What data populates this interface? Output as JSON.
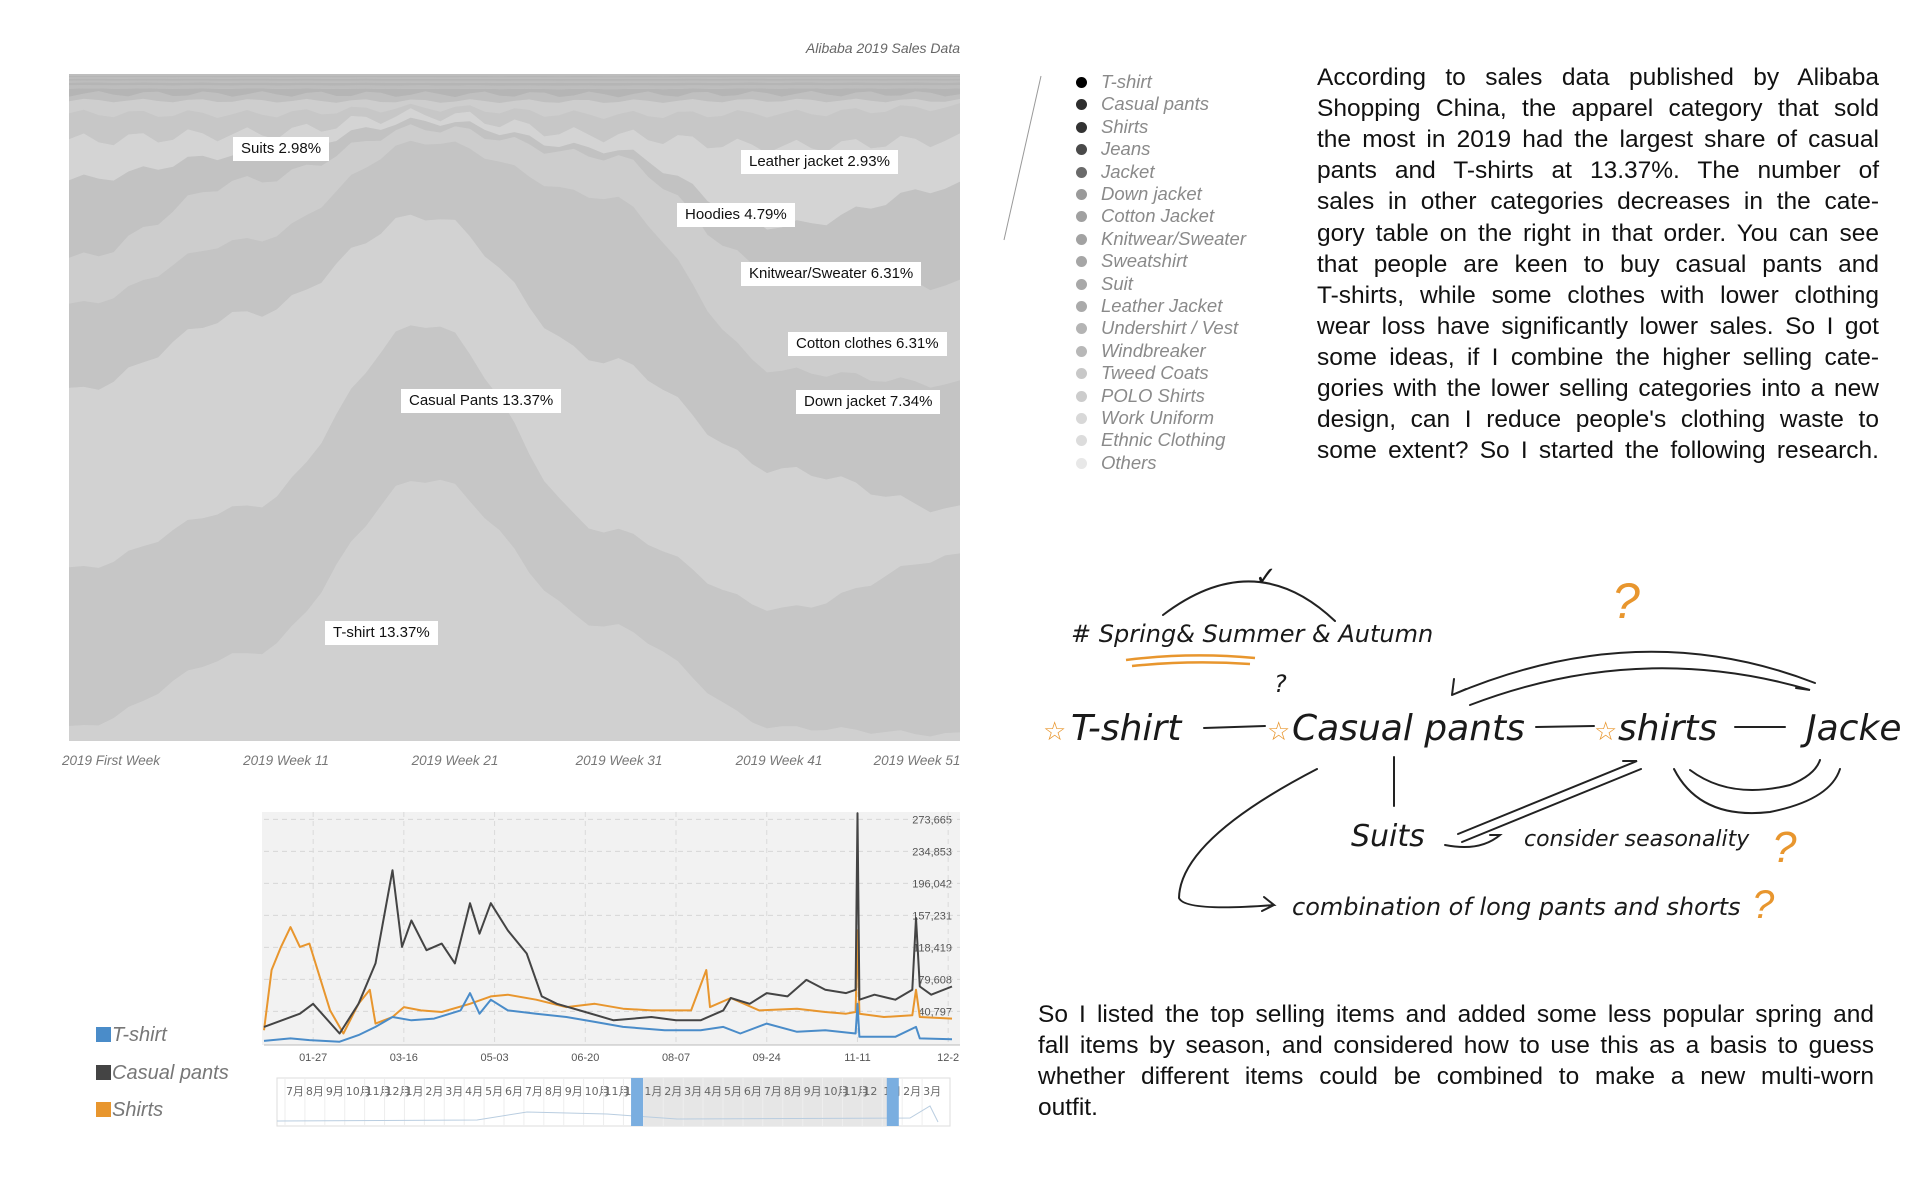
{
  "stream_chart": {
    "title": "Alibaba 2019 Sales Data",
    "week_labels": [
      "2019 First Week",
      "2019 Week 11",
      "2019 Week 21",
      "2019 Week 31",
      "2019 Week 41",
      "2019 Week 51"
    ],
    "labels": [
      {
        "text": "Suits  2.98%"
      },
      {
        "text": "Leather jacket  2.93%"
      },
      {
        "text": "Hoodies  4.79%"
      },
      {
        "text": "Knitwear/Sweater  6.31%"
      },
      {
        "text": "Cotton clothes  6.31%"
      },
      {
        "text": "Down jacket  7.34%"
      },
      {
        "text": "Casual Pants  13.37%"
      },
      {
        "text": "T-shirt  13.37%"
      }
    ]
  },
  "legend": {
    "items": [
      {
        "label": "T-shirt",
        "color": "#000000"
      },
      {
        "label": "Casual pants",
        "color": "#2e2e2e"
      },
      {
        "label": "Shirts",
        "color": "#333333"
      },
      {
        "label": "Jeans",
        "color": "#4a4a4a"
      },
      {
        "label": "Jacket",
        "color": "#6a6a6a"
      },
      {
        "label": "Down jacket",
        "color": "#9a9a9a"
      },
      {
        "label": "Cotton Jacket",
        "color": "#a0a0a0"
      },
      {
        "label": "Knitwear/Sweater",
        "color": "#a2a2a2"
      },
      {
        "label": "Sweatshirt",
        "color": "#a6a6a6"
      },
      {
        "label": "Suit",
        "color": "#a8a8a8"
      },
      {
        "label": "Leather Jacket",
        "color": "#aaaaaa"
      },
      {
        "label": "Undershirt / Vest",
        "color": "#b4b4b4"
      },
      {
        "label": "Windbreaker",
        "color": "#b8b8b8"
      },
      {
        "label": "Tweed Coats",
        "color": "#c8c8c8"
      },
      {
        "label": "POLO Shirts",
        "color": "#cccccc"
      },
      {
        "label": "Work Uniform",
        "color": "#d8d8d8"
      },
      {
        "label": "Ethnic Clothing",
        "color": "#dcdcdc"
      },
      {
        "label": "Others",
        "color": "#e8e8e8"
      }
    ]
  },
  "intro_paragraph": {
    "lines": [
      "According to sales data published by Alibaba",
      "Shopping China, the apparel category that sold",
      "the most in 2019 had the largest share of casual",
      "pants and T-shirts at 13.37%. The number of",
      "sales in other categories decreases in the cate-",
      "gory table on the right in that order. You can see",
      "that people are keen to buy casual pants and",
      "T-shirts, while some clothes with lower clothing",
      "wear loss have significantly lower sales. So I got",
      "some ideas, if I combine the higher selling cate-",
      "gories with the lower selling categories into a new",
      "design, can I reduce people's clothing waste to",
      "some extent? So I started the following research."
    ]
  },
  "sketch": {
    "season_note": "# Spring& Summer & Autumn",
    "items": [
      "T-shirt",
      "Casual pants",
      "shirts",
      "Jacke",
      "Suits"
    ],
    "consider_note": "consider seasonality",
    "combination_note": "combination of long pants and shorts",
    "question_mark": "?",
    "check_mark": "✓",
    "star": "☆",
    "accent_color": "#e8962e"
  },
  "outro_paragraph": {
    "lines": [
      "So I listed the top selling items and added some less popular spring and",
      "fall items by season, and considered how to use this as a basis to guess",
      "whether different items could be combined to make a new multi-worn",
      "outfit."
    ]
  },
  "line_legend": [
    {
      "label": "T-shirt",
      "color": "#4a8cc9"
    },
    {
      "label": "Casual pants",
      "color": "#444444"
    },
    {
      "label": "Shirts",
      "color": "#e8962e"
    }
  ],
  "range_slider": {
    "month_labels": [
      "7月",
      "8月",
      "9月",
      "10月",
      "11月",
      "12月",
      "1月",
      "2月",
      "3月",
      "4月",
      "5月",
      "6月",
      "7月",
      "8月",
      "9月",
      "10月",
      "11月",
      "1月",
      "1月",
      "2月",
      "3月",
      "4月",
      "5月",
      "6月",
      "7月",
      "8月",
      "9月",
      "10月",
      "11月",
      "12",
      "1月",
      "2月",
      "3月"
    ],
    "selection": [
      0.535,
      0.915
    ]
  },
  "chart_data": [
    {
      "type": "area",
      "title": "Alibaba 2019 Sales Data",
      "stacking": "percent (streamgraph)",
      "categories": [
        "2019 First Week",
        "2019 Week 11",
        "2019 Week 21",
        "2019 Week 31",
        "2019 Week 41",
        "2019 Week 51"
      ],
      "series": [
        {
          "name": "T-shirt",
          "values": [
            2,
            13,
            39,
            17,
            2,
            1
          ]
        },
        {
          "name": "Casual pants",
          "values": [
            24,
            22,
            23,
            14,
            18,
            27
          ]
        },
        {
          "name": "Shirts",
          "values": [
            27,
            29,
            16,
            25,
            21,
            7
          ]
        },
        {
          "name": "Jeans",
          "values": [
            13,
            11,
            11,
            24,
            15,
            19
          ]
        },
        {
          "name": "Jacket",
          "values": [
            7,
            9,
            2,
            6,
            15,
            15
          ]
        },
        {
          "name": "Down jacket",
          "values": [
            12,
            4,
            1,
            1,
            7,
            15
          ]
        },
        {
          "name": "Cotton Jacket",
          "values": [
            6,
            3,
            1,
            2,
            12,
            7
          ]
        },
        {
          "name": "Knitwear/Sweater",
          "values": [
            4,
            3,
            1,
            3,
            5,
            5
          ]
        },
        {
          "name": "Sweatshirt",
          "values": [
            2,
            2,
            1,
            2,
            2,
            1
          ]
        },
        {
          "name": "Suit",
          "values": [
            1,
            1,
            1,
            1,
            1,
            1
          ]
        },
        {
          "name": "Leather Jacket",
          "values": [
            0.8,
            0.8,
            0.8,
            0.8,
            0.8,
            0.8
          ]
        },
        {
          "name": "Undershirt / Vest",
          "values": [
            0.5,
            0.5,
            0.5,
            0.5,
            0.5,
            0.5
          ]
        },
        {
          "name": "Windbreaker",
          "values": [
            0.4,
            0.4,
            0.4,
            0.4,
            0.4,
            0.4
          ]
        },
        {
          "name": "Tweed Coats",
          "values": [
            0.3,
            0.3,
            0.3,
            0.3,
            0.3,
            0.3
          ]
        },
        {
          "name": "POLO Shirts",
          "values": [
            0.3,
            0.3,
            0.3,
            0.3,
            0.3,
            0.3
          ]
        },
        {
          "name": "Work Uniform",
          "values": [
            0.2,
            0.2,
            0.2,
            0.2,
            0.2,
            0.2
          ]
        },
        {
          "name": "Ethnic Clothing",
          "values": [
            0.2,
            0.2,
            0.2,
            0.2,
            0.2,
            0.2
          ]
        },
        {
          "name": "Others",
          "values": [
            0.3,
            0.3,
            0.3,
            0.3,
            0.3,
            0.3
          ]
        }
      ],
      "grid": false,
      "legend": "right"
    },
    {
      "type": "line",
      "x_ticks": [
        "01-27",
        "03-16",
        "05-03",
        "06-20",
        "08-07",
        "09-24",
        "11-11",
        "12-2"
      ],
      "y_ticks": [
        "273,665",
        "234,853",
        "196,042",
        "157,231",
        "118,419",
        "79,608",
        "40,797"
      ],
      "ylim": [
        0,
        282600
      ],
      "grid": true,
      "legend": "bottom-left",
      "series": [
        {
          "name": "T-shirt",
          "color": "#4a8cc9",
          "points": [
            [
              "01-01",
              5000
            ],
            [
              "01-15",
              8000
            ],
            [
              "01-25",
              6000
            ],
            [
              "02-10",
              4000
            ],
            [
              "02-20",
              12000
            ],
            [
              "03-01",
              22000
            ],
            [
              "03-10",
              34000
            ],
            [
              "03-20",
              30000
            ],
            [
              "04-01",
              32000
            ],
            [
              "04-15",
              42000
            ],
            [
              "04-20",
              63000
            ],
            [
              "04-25",
              38000
            ],
            [
              "05-01",
              55000
            ],
            [
              "05-10",
              42000
            ],
            [
              "05-25",
              38000
            ],
            [
              "06-10",
              34000
            ],
            [
              "06-25",
              28000
            ],
            [
              "07-10",
              22000
            ],
            [
              "08-01",
              18000
            ],
            [
              "08-20",
              18000
            ],
            [
              "09-01",
              22000
            ],
            [
              "09-10",
              14000
            ],
            [
              "09-24",
              26000
            ],
            [
              "10-10",
              16000
            ],
            [
              "10-25",
              18000
            ],
            [
              "11-10",
              14000
            ],
            [
              "11-11",
              50000
            ],
            [
              "11-12",
              10000
            ],
            [
              "12-01",
              10000
            ],
            [
              "12-12",
              22000
            ],
            [
              "12-14",
              8000
            ],
            [
              "12-31",
              7000
            ]
          ]
        },
        {
          "name": "Casual pants",
          "color": "#444444",
          "points": [
            [
              "01-01",
              22000
            ],
            [
              "01-20",
              38000
            ],
            [
              "01-27",
              50000
            ],
            [
              "02-10",
              14000
            ],
            [
              "02-20",
              50000
            ],
            [
              "03-01",
              99000
            ],
            [
              "03-10",
              212000
            ],
            [
              "03-15",
              119000
            ],
            [
              "03-20",
              151000
            ],
            [
              "03-28",
              115000
            ],
            [
              "04-05",
              123000
            ],
            [
              "04-12",
              99000
            ],
            [
              "04-20",
              172000
            ],
            [
              "04-25",
              135000
            ],
            [
              "05-01",
              172000
            ],
            [
              "05-10",
              139000
            ],
            [
              "05-20",
              111000
            ],
            [
              "05-28",
              59000
            ],
            [
              "06-05",
              50000
            ],
            [
              "06-20",
              40000
            ],
            [
              "07-05",
              30000
            ],
            [
              "07-25",
              34000
            ],
            [
              "08-07",
              30000
            ],
            [
              "08-20",
              30000
            ],
            [
              "09-01",
              42000
            ],
            [
              "09-05",
              57000
            ],
            [
              "09-15",
              50000
            ],
            [
              "09-24",
              63000
            ],
            [
              "10-05",
              59000
            ],
            [
              "10-15",
              79000
            ],
            [
              "10-25",
              67000
            ],
            [
              "11-05",
              63000
            ],
            [
              "11-10",
              67000
            ],
            [
              "11-11",
              281000
            ],
            [
              "11-12",
              55000
            ],
            [
              "11-20",
              61000
            ],
            [
              "12-01",
              55000
            ],
            [
              "12-10",
              67000
            ],
            [
              "12-12",
              154000
            ],
            [
              "12-14",
              71000
            ],
            [
              "12-20",
              61000
            ],
            [
              "12-31",
              71000
            ]
          ]
        },
        {
          "name": "Shirts",
          "color": "#e8962e",
          "points": [
            [
              "01-01",
              18000
            ],
            [
              "01-05",
              91000
            ],
            [
              "01-10",
              119000
            ],
            [
              "01-15",
              143000
            ],
            [
              "01-20",
              119000
            ],
            [
              "01-25",
              123000
            ],
            [
              "02-05",
              42000
            ],
            [
              "02-12",
              14000
            ],
            [
              "02-20",
              50000
            ],
            [
              "02-26",
              67000
            ],
            [
              "03-01",
              26000
            ],
            [
              "03-10",
              34000
            ],
            [
              "03-16",
              46000
            ],
            [
              "03-25",
              42000
            ],
            [
              "04-05",
              40000
            ],
            [
              "04-20",
              50000
            ],
            [
              "05-01",
              59000
            ],
            [
              "05-10",
              61000
            ],
            [
              "05-25",
              55000
            ],
            [
              "06-10",
              46000
            ],
            [
              "06-25",
              50000
            ],
            [
              "07-10",
              44000
            ],
            [
              "07-25",
              42000
            ],
            [
              "08-15",
              42000
            ],
            [
              "08-23",
              91000
            ],
            [
              "08-25",
              46000
            ],
            [
              "09-05",
              57000
            ],
            [
              "09-20",
              42000
            ],
            [
              "10-10",
              44000
            ],
            [
              "10-25",
              40000
            ],
            [
              "11-05",
              38000
            ],
            [
              "11-10",
              40000
            ],
            [
              "11-11",
              139000
            ],
            [
              "11-12",
              38000
            ],
            [
              "11-25",
              34000
            ],
            [
              "12-10",
              36000
            ],
            [
              "12-12",
              67000
            ],
            [
              "12-14",
              34000
            ],
            [
              "12-31",
              32000
            ]
          ]
        }
      ]
    }
  ]
}
